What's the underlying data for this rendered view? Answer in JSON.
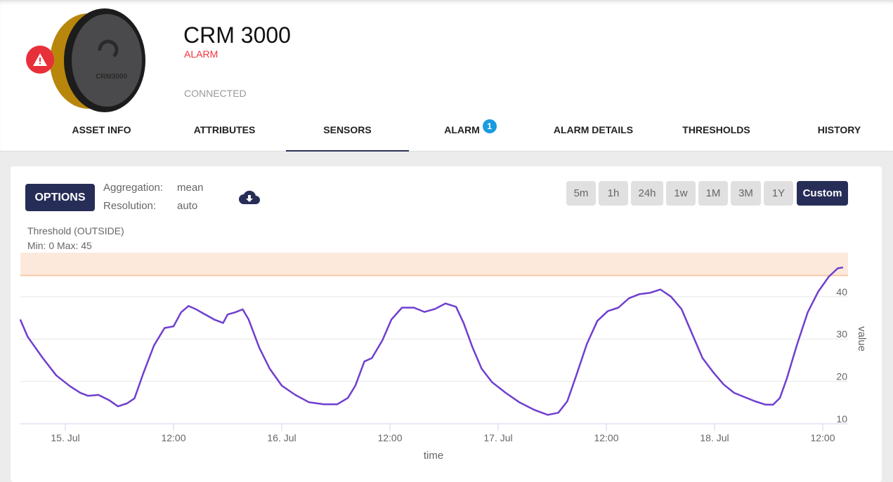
{
  "asset": {
    "title": "CRM 3000",
    "status": "ALARM",
    "connection": "CONNECTED",
    "device_label": "CRM3000",
    "status_color": "#f2333c"
  },
  "tabs": [
    {
      "label": "ASSET INFO"
    },
    {
      "label": "ATTRIBUTES"
    },
    {
      "label": "SENSORS",
      "active": true
    },
    {
      "label": "ALARM",
      "badge": "1"
    },
    {
      "label": "ALARM DETAILS"
    },
    {
      "label": "THRESHOLDS"
    },
    {
      "label": "HISTORY"
    }
  ],
  "toolbar": {
    "options_label": "OPTIONS",
    "aggregation_label": "Aggregation:",
    "aggregation_value": "mean",
    "resolution_label": "Resolution:",
    "resolution_value": "auto",
    "download_icon": "cloud-download-icon",
    "ranges": [
      "5m",
      "1h",
      "24h",
      "1w",
      "1M",
      "3M",
      "1Y",
      "Custom"
    ],
    "selected_range": "Custom"
  },
  "threshold": {
    "title": "Threshold (OUTSIDE)",
    "limits": "Min: 0 Max: 45",
    "min": 0,
    "max": 45,
    "band_color": "#fde9dc"
  },
  "chart_data": {
    "type": "line",
    "xlabel": "time",
    "ylabel": "value",
    "x_ticks": [
      "15. Jul",
      "12:00",
      "16. Jul",
      "12:00",
      "17. Jul",
      "12:00",
      "18. Jul",
      "12:00"
    ],
    "y_ticks": [
      10,
      20,
      30,
      40
    ],
    "ylim": [
      10,
      50
    ],
    "grid": true,
    "line_color": "#6f3fcf",
    "series": [
      {
        "points": [
          [
            "14 Jul 19:00",
            34.6
          ],
          [
            "14 Jul 19:50",
            30.5
          ],
          [
            "14 Jul 21:30",
            25.5
          ],
          [
            "14 Jul 23:00",
            21.4
          ],
          [
            "15 Jul 00:30",
            18.9
          ],
          [
            "15 Jul 01:40",
            17.3
          ],
          [
            "15 Jul 02:30",
            16.6
          ],
          [
            "15 Jul 03:40",
            16.8
          ],
          [
            "15 Jul 04:50",
            15.6
          ],
          [
            "15 Jul 05:50",
            14.1
          ],
          [
            "15 Jul 06:50",
            14.8
          ],
          [
            "15 Jul 07:40",
            16.0
          ],
          [
            "15 Jul 08:40",
            22.0
          ],
          [
            "15 Jul 09:50",
            28.5
          ],
          [
            "15 Jul 11:00",
            32.6
          ],
          [
            "15 Jul 12:00",
            33.0
          ],
          [
            "15 Jul 12:50",
            36.3
          ],
          [
            "15 Jul 13:40",
            37.8
          ],
          [
            "15 Jul 14:30",
            37.0
          ],
          [
            "15 Jul 15:20",
            36.0
          ],
          [
            "15 Jul 16:30",
            34.6
          ],
          [
            "15 Jul 17:30",
            33.8
          ],
          [
            "15 Jul 18:00",
            35.8
          ],
          [
            "15 Jul 18:50",
            36.3
          ],
          [
            "15 Jul 19:40",
            37.0
          ],
          [
            "15 Jul 20:20",
            34.6
          ],
          [
            "15 Jul 21:30",
            28.0
          ],
          [
            "15 Jul 22:40",
            23.0
          ],
          [
            "16 Jul 00:00",
            19.0
          ],
          [
            "16 Jul 01:30",
            16.8
          ],
          [
            "16 Jul 03:00",
            15.1
          ],
          [
            "16 Jul 04:40",
            14.6
          ],
          [
            "16 Jul 06:10",
            14.6
          ],
          [
            "16 Jul 07:20",
            16.1
          ],
          [
            "16 Jul 08:10",
            19.0
          ],
          [
            "16 Jul 09:10",
            24.7
          ],
          [
            "16 Jul 10:00",
            25.5
          ],
          [
            "16 Jul 11:10",
            29.7
          ],
          [
            "16 Jul 12:10",
            34.6
          ],
          [
            "16 Jul 13:20",
            37.4
          ],
          [
            "16 Jul 14:40",
            37.4
          ],
          [
            "16 Jul 15:50",
            36.4
          ],
          [
            "16 Jul 17:00",
            37.1
          ],
          [
            "16 Jul 18:10",
            38.4
          ],
          [
            "16 Jul 19:20",
            37.6
          ],
          [
            "16 Jul 20:10",
            33.8
          ],
          [
            "16 Jul 21:10",
            28.0
          ],
          [
            "16 Jul 22:10",
            23.0
          ],
          [
            "16 Jul 23:20",
            19.8
          ],
          [
            "17 Jul 00:50",
            17.3
          ],
          [
            "17 Jul 02:20",
            15.1
          ],
          [
            "17 Jul 04:00",
            13.3
          ],
          [
            "17 Jul 05:30",
            12.1
          ],
          [
            "17 Jul 06:40",
            12.6
          ],
          [
            "17 Jul 07:40",
            15.3
          ],
          [
            "17 Jul 08:40",
            21.4
          ],
          [
            "17 Jul 09:50",
            28.8
          ],
          [
            "17 Jul 11:00",
            34.3
          ],
          [
            "17 Jul 12:10",
            36.6
          ],
          [
            "17 Jul 13:20",
            37.4
          ],
          [
            "17 Jul 14:30",
            39.6
          ],
          [
            "17 Jul 15:40",
            40.6
          ],
          [
            "17 Jul 16:50",
            40.9
          ],
          [
            "17 Jul 18:00",
            41.7
          ],
          [
            "17 Jul 19:10",
            40.0
          ],
          [
            "17 Jul 20:20",
            37.1
          ],
          [
            "17 Jul 21:30",
            31.3
          ],
          [
            "17 Jul 22:40",
            25.5
          ],
          [
            "17 Jul 23:50",
            22.2
          ],
          [
            "18 Jul 01:00",
            19.3
          ],
          [
            "18 Jul 02:10",
            17.3
          ],
          [
            "18 Jul 03:20",
            16.3
          ],
          [
            "18 Jul 04:30",
            15.3
          ],
          [
            "18 Jul 05:40",
            14.5
          ],
          [
            "18 Jul 06:30",
            14.5
          ],
          [
            "18 Jul 07:15",
            16.1
          ],
          [
            "18 Jul 08:00",
            20.6
          ],
          [
            "18 Jul 09:10",
            28.8
          ],
          [
            "18 Jul 10:20",
            36.3
          ],
          [
            "18 Jul 11:30",
            41.2
          ],
          [
            "18 Jul 12:40",
            44.7
          ],
          [
            "18 Jul 13:40",
            46.7
          ],
          [
            "18 Jul 14:15",
            46.9
          ]
        ]
      }
    ]
  }
}
